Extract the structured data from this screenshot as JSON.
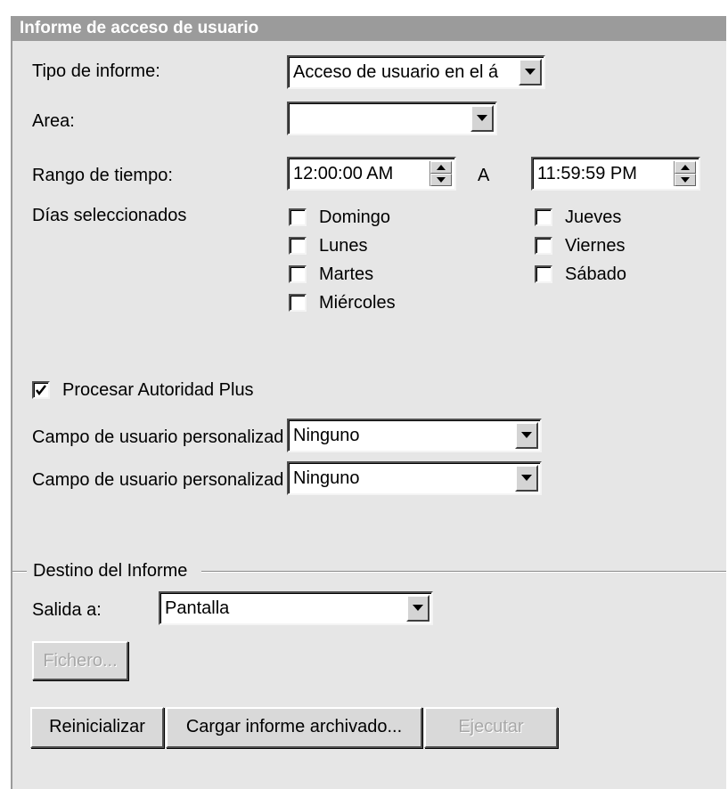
{
  "window": {
    "title": "Informe de acceso de usuario"
  },
  "report_type": {
    "label": "Tipo de informe:",
    "value": "Acceso de usuario en el á"
  },
  "area": {
    "label": "Area:",
    "value": ""
  },
  "time_range": {
    "label": "Rango de tiempo:",
    "start": "12:00:00 AM",
    "separator": "A",
    "end": "11:59:59 PM"
  },
  "days": {
    "label": "Días seleccionados",
    "items": [
      {
        "label": "Domingo",
        "checked": false
      },
      {
        "label": "Lunes",
        "checked": false
      },
      {
        "label": "Martes",
        "checked": false
      },
      {
        "label": "Miércoles",
        "checked": false
      },
      {
        "label": "Jueves",
        "checked": false
      },
      {
        "label": "Viernes",
        "checked": false
      },
      {
        "label": "Sábado",
        "checked": false
      }
    ]
  },
  "authority_plus": {
    "label": "Procesar Autoridad Plus",
    "checked": true
  },
  "custom_field_1": {
    "label": "Campo de usuario personalizad",
    "value": "Ninguno"
  },
  "custom_field_2": {
    "label": "Campo de usuario personalizad",
    "value": "Ninguno"
  },
  "destination": {
    "group_label": "Destino del Informe",
    "output_label": "Salida a:",
    "output_value": "Pantalla"
  },
  "buttons": {
    "file": "Fichero...",
    "reset": "Reinicializar",
    "load_archived": "Cargar informe archivado...",
    "run": "Ejecutar"
  }
}
